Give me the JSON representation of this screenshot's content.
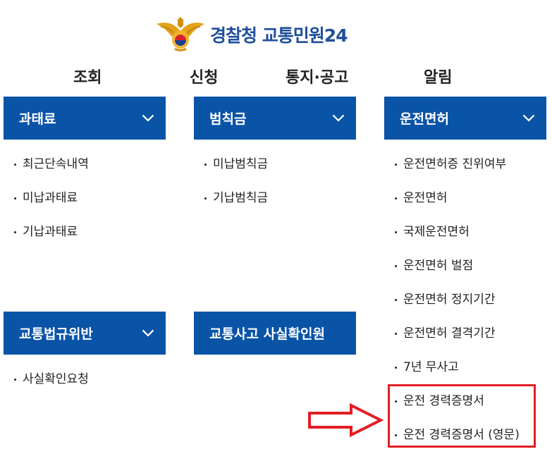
{
  "header": {
    "logo_icon": "police-emblem-icon",
    "title_main": "경찰청 교통민원",
    "title_num": "24"
  },
  "top_nav": {
    "inquiry": "조회",
    "apply": "신청",
    "notice": "통지·공고",
    "alert": "알림"
  },
  "sections": {
    "fine": {
      "title": "과태료",
      "items": [
        "최근단속내역",
        "미납과태료",
        "기납과태료"
      ]
    },
    "penalty": {
      "title": "범칙금",
      "items": [
        "미납범칙금",
        "기납범칙금"
      ]
    },
    "license": {
      "title": "운전면허",
      "items": [
        "운전면허증 진위여부",
        "운전면허",
        "국제운전면허",
        "운전면허 벌점",
        "운전면허 정지기간",
        "운전면허 결격기간",
        "7년 무사고",
        "운전 경력증명서",
        "운전 경력증명서 (영문)"
      ]
    },
    "violation": {
      "title": "교통법규위반",
      "items": [
        "사실확인요청"
      ]
    },
    "accident": {
      "title": "교통사고 사실확인원"
    }
  },
  "colors": {
    "accent": "#0a54a8",
    "logo_text": "#1f4e9c",
    "highlight": "#e31e24"
  },
  "icons": {
    "expand": "chevron-down-icon",
    "annotation_arrow": "right-arrow-icon"
  }
}
